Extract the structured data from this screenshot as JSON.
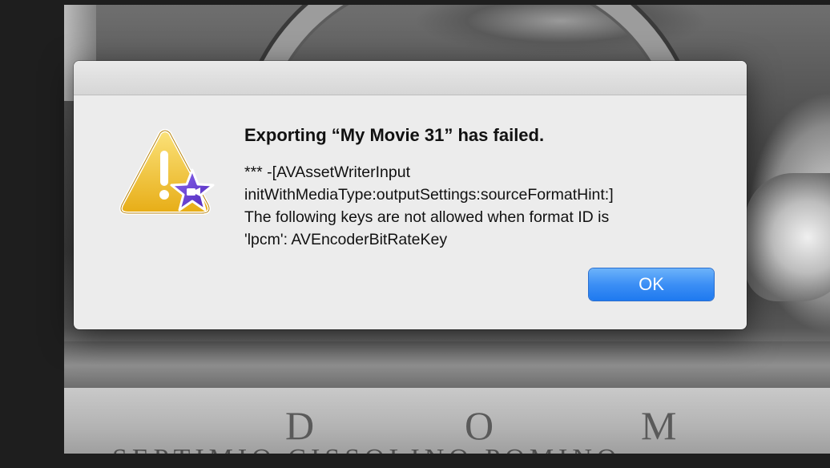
{
  "dialog": {
    "title": "Exporting “My Movie 31” has failed.",
    "message": "*** -[AVAssetWriterInput\ninitWithMediaType:outputSettings:sourceFormatHint:]\nThe following keys are not allowed when format ID is\n'lpcm': AVEncoderBitRateKey",
    "ok_label": "OK",
    "icon": "caution-imovie-icon"
  },
  "background": {
    "inscription_letters": [
      "D",
      "O",
      "M"
    ],
    "inscription_line": "SEPTIMIO CISSOLINO POMINO"
  },
  "colors": {
    "dialog_bg": "#ececec",
    "button_blue": "#3c8ff5",
    "warning_yellow": "#f3c53a",
    "imovie_purple": "#6a3fd0"
  }
}
